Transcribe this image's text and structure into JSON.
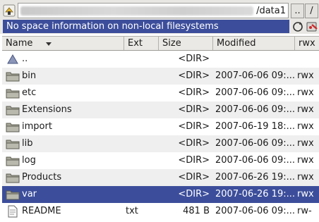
{
  "pathbar": {
    "path_visible_tail": "/data1",
    "up_label": "..",
    "root_label": "/"
  },
  "infobar": {
    "message": "No space information on non-local filesystems"
  },
  "columns": {
    "name": "Name",
    "ext": "Ext",
    "size": "Size",
    "modified": "Modified",
    "rwx": "rwx",
    "sort_column": "name",
    "sort_direction": "descending"
  },
  "rows": [
    {
      "name": "..",
      "ext": "",
      "size": "<DIR>",
      "modified": "",
      "rwx": "",
      "icon": "up-dir-icon"
    },
    {
      "name": "bin",
      "ext": "",
      "size": "<DIR>",
      "modified": "2007-06-06 09:...",
      "rwx": "rwx",
      "icon": "folder-icon"
    },
    {
      "name": "etc",
      "ext": "",
      "size": "<DIR>",
      "modified": "2007-06-06 09:...",
      "rwx": "rwx",
      "icon": "folder-icon"
    },
    {
      "name": "Extensions",
      "ext": "",
      "size": "<DIR>",
      "modified": "2007-06-06 09:...",
      "rwx": "rwx",
      "icon": "folder-icon"
    },
    {
      "name": "import",
      "ext": "",
      "size": "<DIR>",
      "modified": "2007-06-19 18:...",
      "rwx": "rwx",
      "icon": "folder-icon"
    },
    {
      "name": "lib",
      "ext": "",
      "size": "<DIR>",
      "modified": "2007-06-06 09:...",
      "rwx": "rwx",
      "icon": "folder-icon"
    },
    {
      "name": "log",
      "ext": "",
      "size": "<DIR>",
      "modified": "2007-06-06 09:...",
      "rwx": "rwx",
      "icon": "folder-icon"
    },
    {
      "name": "Products",
      "ext": "",
      "size": "<DIR>",
      "modified": "2007-06-26 19:...",
      "rwx": "rwx",
      "icon": "folder-icon"
    },
    {
      "name": "var",
      "ext": "",
      "size": "<DIR>",
      "modified": "2007-06-26 19:...",
      "rwx": "rwx",
      "icon": "folder-icon",
      "selected": true
    },
    {
      "name": "README",
      "ext": "txt",
      "size": "481 B",
      "modified": "2007-06-06 09:...",
      "rwx": "rw-",
      "icon": "text-file-icon"
    }
  ],
  "colors": {
    "selection": "#3c4e9b",
    "folder": "#9a9a8e",
    "toolbar": "#e9e7e3"
  }
}
